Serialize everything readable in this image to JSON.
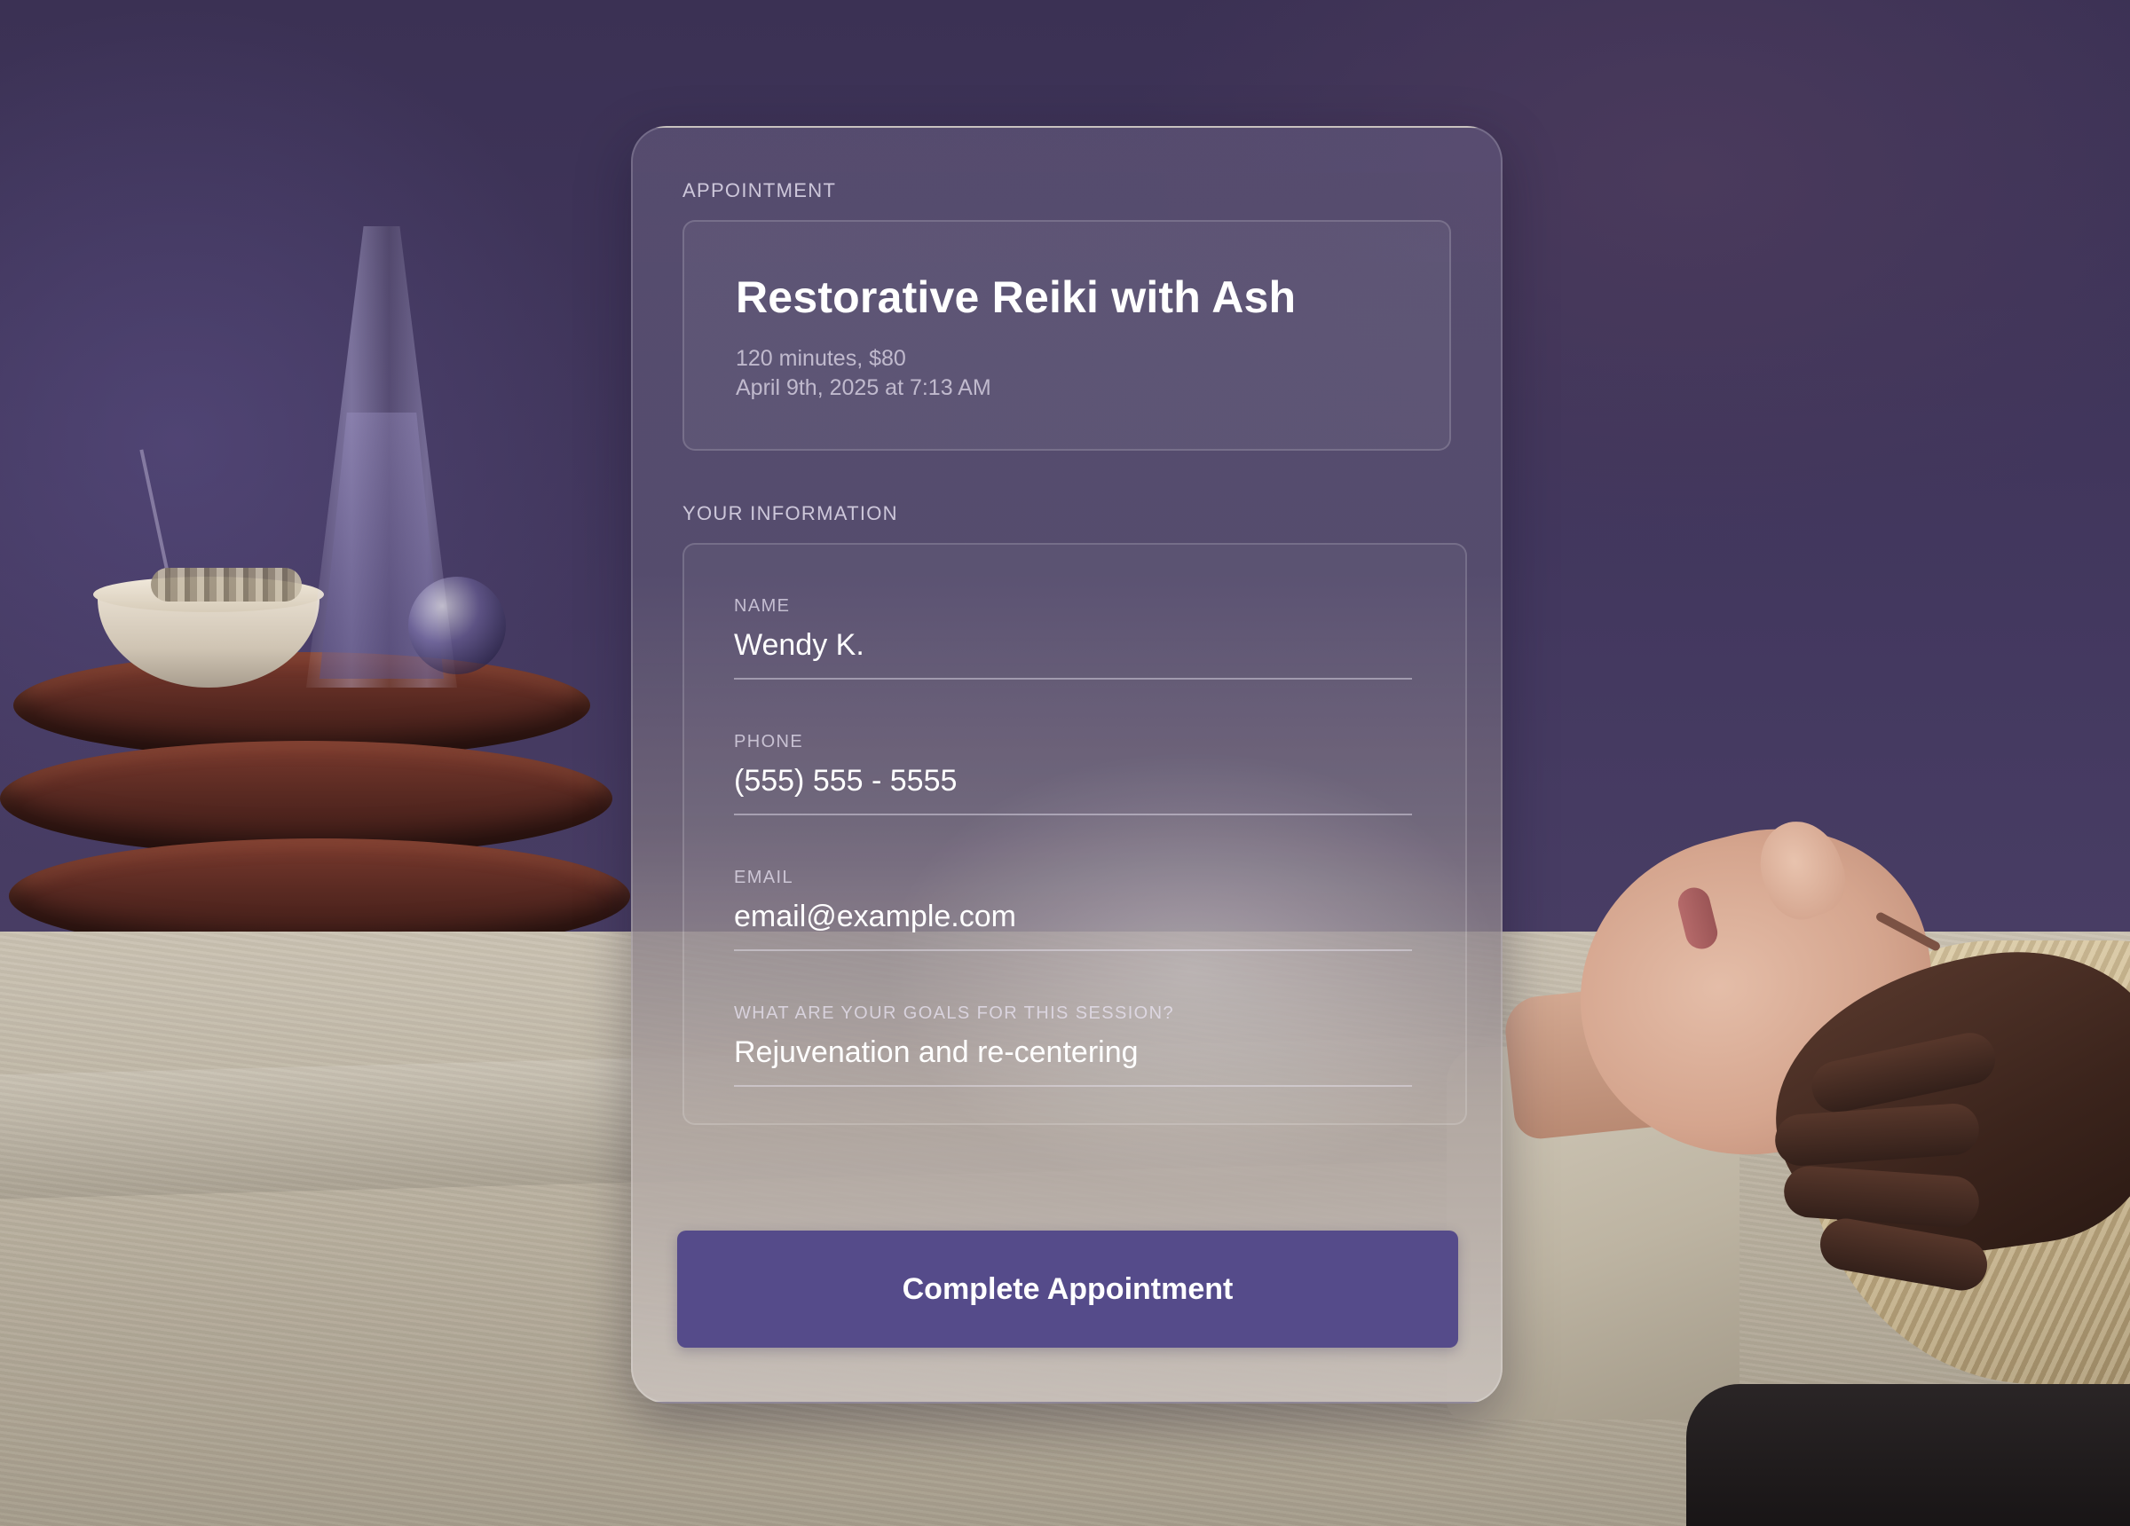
{
  "appointment": {
    "section_label": "APPOINTMENT",
    "title": "Restorative Reiki with Ash",
    "duration_price": "120 minutes, $80",
    "datetime": "April 9th, 2025 at 7:13 AM"
  },
  "info": {
    "section_label": "YOUR INFORMATION",
    "fields": [
      {
        "label": "NAME",
        "value": "Wendy K."
      },
      {
        "label": "PHONE",
        "value": "(555) 555 - 5555"
      },
      {
        "label": "EMAIL",
        "value": "email@example.com"
      },
      {
        "label": "WHAT ARE YOUR GOALS FOR THIS SESSION?",
        "value": "Rejuvenation and re-centering"
      }
    ]
  },
  "cta": {
    "label": "Complete Appointment"
  },
  "colors": {
    "accent": "#554b8a",
    "background": "#3f3758"
  }
}
